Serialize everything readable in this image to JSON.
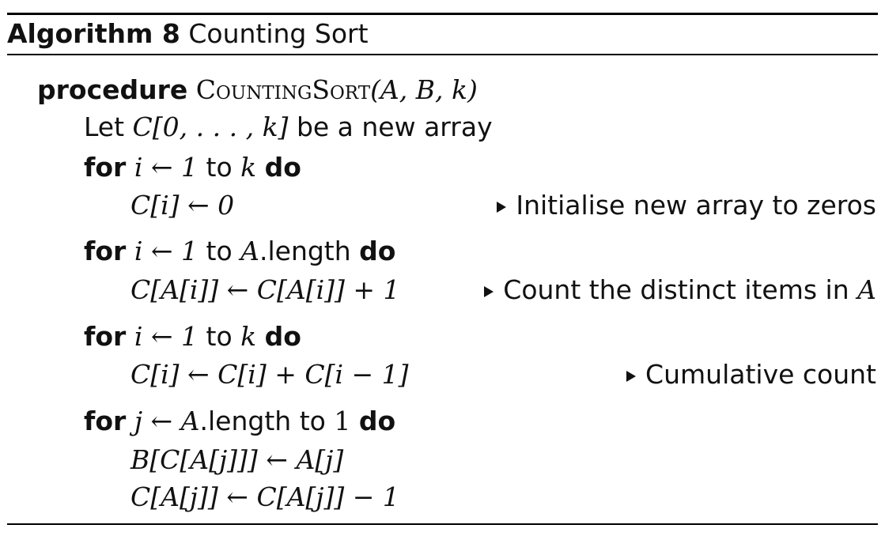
{
  "algorithm": {
    "label": "Algorithm 8",
    "title": "Counting Sort"
  },
  "lines": {
    "procedure_kw": "procedure",
    "procedure_name": "CountingSort",
    "procedure_args": "(A, B, k)",
    "let_prefix": "Let",
    "let_math": "C[0, . . . , k]",
    "let_suffix": "be a new array",
    "for_kw": "for",
    "do_kw": "do",
    "to_word": "to",
    "loop1_var": "i ← 1",
    "loop1_end": "k",
    "stmt1": "C[i] ← 0",
    "loop2_var": "i ← 1",
    "loop2_end_obj": "A",
    "loop2_end_attr": ".length",
    "stmt2": "C[A[i]] ← C[A[i]] + 1",
    "loop3_var": "i ← 1",
    "loop3_end": "k",
    "stmt3": "C[i] ← C[i] + C[i − 1]",
    "loop4_var_obj": "j ← A",
    "loop4_var_attr": ".length",
    "loop4_end": "1",
    "stmt4a": "B[C[A[j]]] ← A[j]",
    "stmt4b": "C[A[j]] ← C[A[j]] − 1"
  },
  "comments": {
    "c1": "Initialise new array to zeros",
    "c2_text": "Count the distinct items in",
    "c2_var": "A",
    "c3": "Cumulative count"
  }
}
